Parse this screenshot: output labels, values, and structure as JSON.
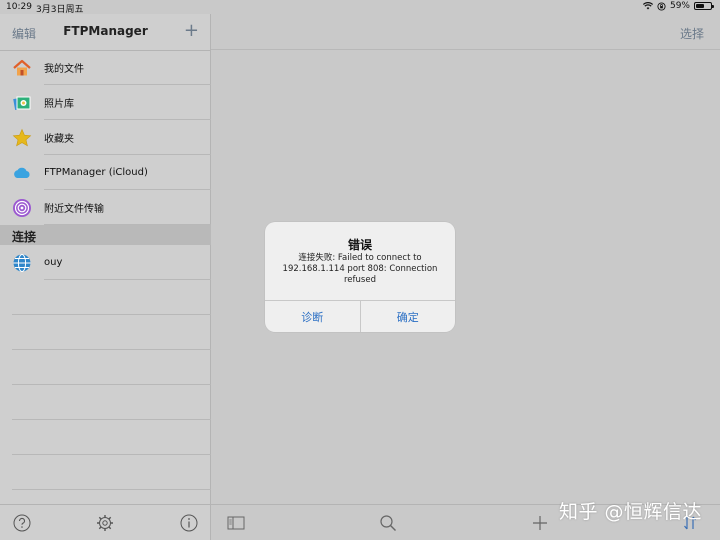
{
  "status_bar": {
    "time": "10:29",
    "date": "3月3日周五",
    "battery_text": "59%",
    "battery_level": 0.59
  },
  "sidebar": {
    "edit_label": "编辑",
    "title": "FTPManager",
    "add_label": "+",
    "items": [
      {
        "label": "我的文件",
        "icon": "home-icon"
      },
      {
        "label": "照片库",
        "icon": "photos-icon"
      },
      {
        "label": "收藏夹",
        "icon": "star-icon"
      },
      {
        "label": "FTPManager (iCloud)",
        "icon": "cloud-icon"
      },
      {
        "label": "附近文件传输",
        "icon": "airdrop-icon"
      }
    ],
    "section_label": "连接",
    "connections": [
      {
        "label": "ouy",
        "icon": "globe-icon"
      }
    ]
  },
  "main": {
    "select_label": "选择"
  },
  "alert": {
    "title": "错误",
    "message": "连接失败: Failed to connect to 192.168.1.114 port 808: Connection refused",
    "diagnose_label": "诊断",
    "ok_label": "确定"
  },
  "watermark": "知乎 @恒辉信达",
  "colors": {
    "accent": "#2b6fc4",
    "nav_gray": "#6b7a8a",
    "background": "#c9c9c9"
  }
}
